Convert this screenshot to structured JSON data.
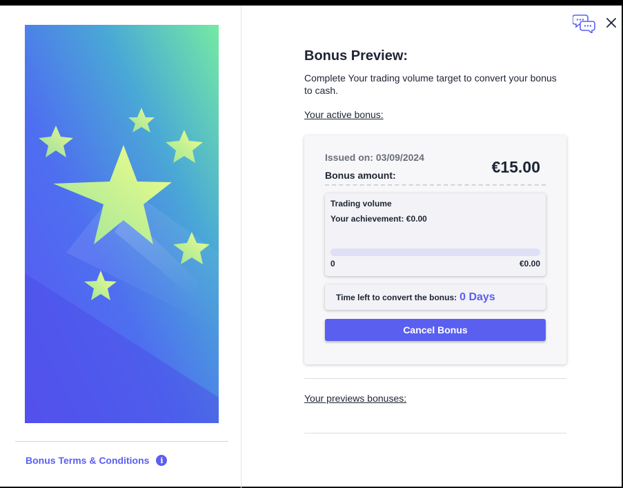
{
  "panel": {
    "title": "Bonus Preview:",
    "subtitle": "Complete Your trading volume target to convert your bonus to cash.",
    "active_label": "Your active bonus:",
    "previous_label": "Your previews bonuses:"
  },
  "bonus": {
    "issued": "Issued on: 03/09/2024",
    "amount_label": "Bonus amount:",
    "amount_value": "€15.00",
    "volume_title": "Trading volume",
    "achievement": "Your achievement: €0.00",
    "progress_fraction": 0,
    "progress_min": "0",
    "progress_max": "€0.00",
    "time_label": "Time left to convert the bonus:",
    "time_value": "0 Days",
    "cancel_label": "Cancel Bonus"
  },
  "sidebar": {
    "terms_label": "Bonus Terms & Conditions",
    "info_glyph": "i"
  },
  "icons": {
    "chat": "chat-bubbles-icon",
    "close": "close-icon",
    "info": "info-icon"
  },
  "colors": {
    "accent": "#5a5ff0",
    "text": "#1d2433",
    "muted": "#6b6f78",
    "card_bg": "#f7f7f9"
  }
}
